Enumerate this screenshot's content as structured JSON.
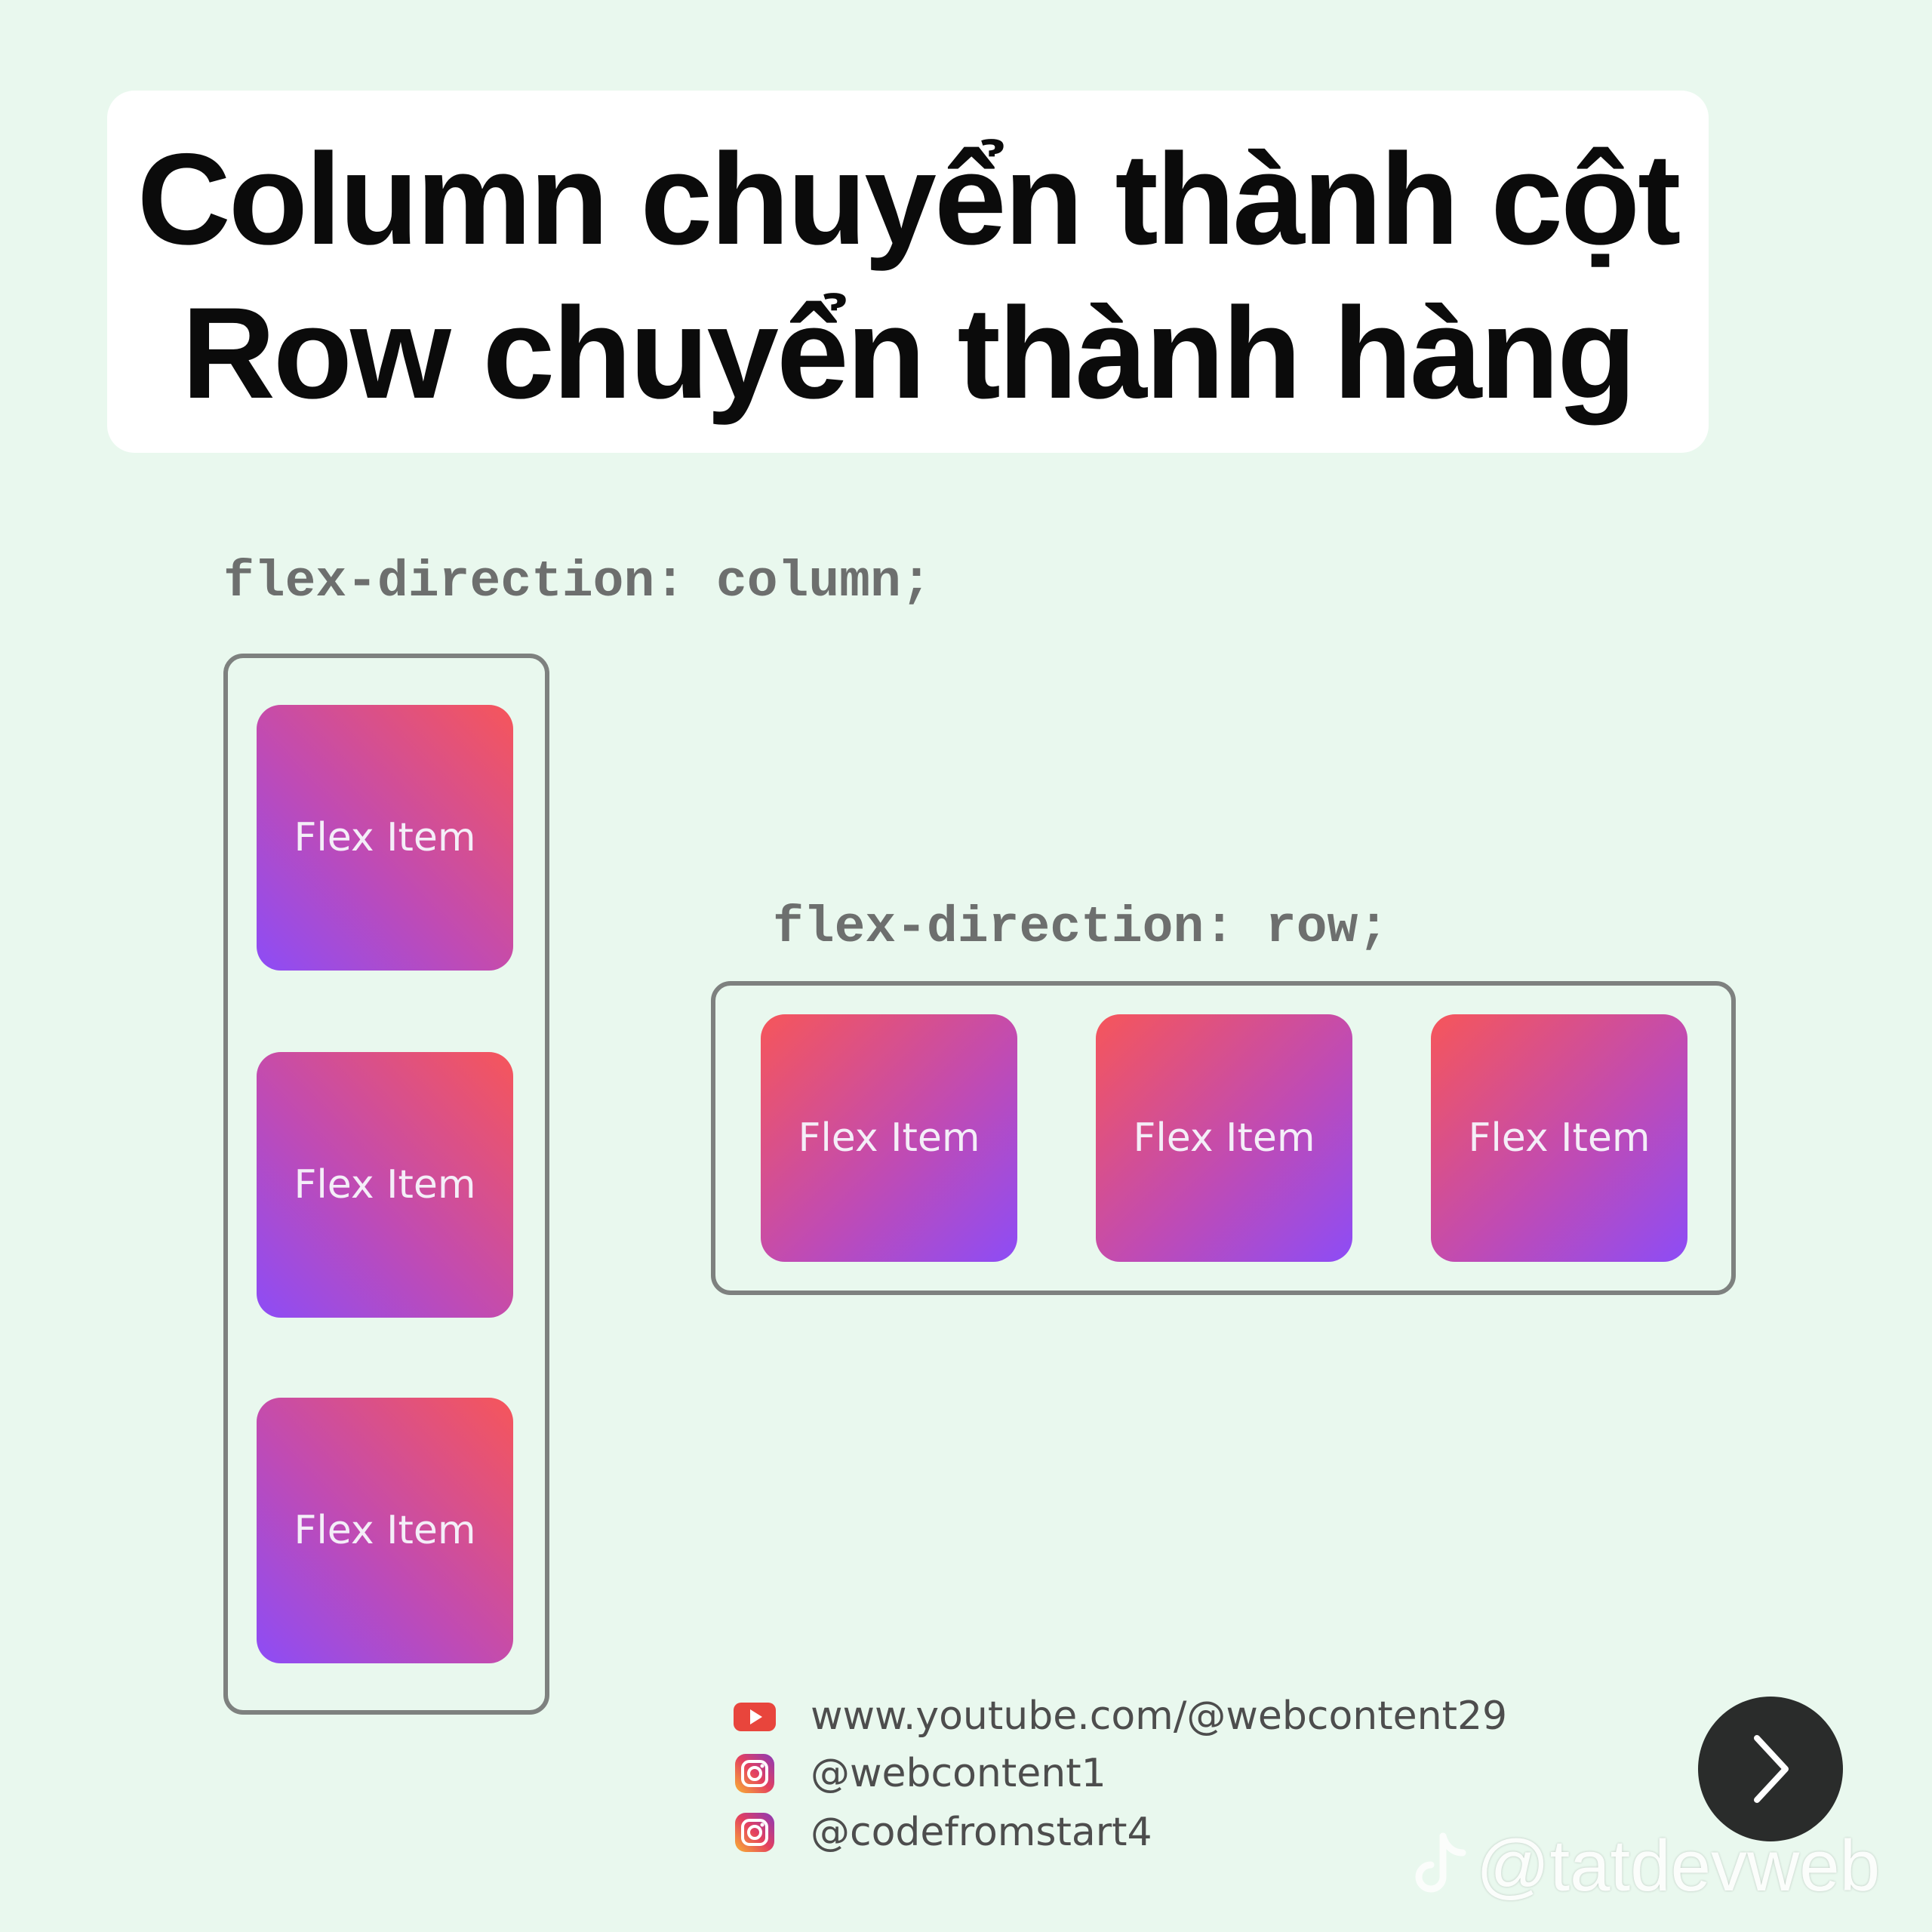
{
  "title": {
    "line1": "Column chuyển thành cột",
    "line2": "Row chuyển thành hàng"
  },
  "column_demo": {
    "code_label": "flex-direction: column;",
    "items": [
      "Flex Item",
      "Flex Item",
      "Flex Item"
    ]
  },
  "row_demo": {
    "code_label": "flex-direction: row;",
    "items": [
      "Flex Item",
      "Flex Item",
      "Flex Item"
    ]
  },
  "footer": {
    "links": [
      {
        "icon": "youtube-icon",
        "text": "www.youtube.com/@webcontent29"
      },
      {
        "icon": "instagram-icon",
        "text": "@webcontent1"
      },
      {
        "icon": "instagram-icon",
        "text": "@codefromstart4"
      }
    ]
  },
  "navigation": {
    "next_icon": "chevron-right-icon"
  },
  "watermark": {
    "icon": "tiktok-icon",
    "text": "@tatdevweb"
  },
  "colors": {
    "background": "#e9f8ee",
    "card": "#ffffff",
    "item_gradient_start": "#f6565a",
    "item_gradient_end": "#8d4cf6",
    "container_border": "#7e817f",
    "code_text": "#6d6f6e",
    "next_button": "#2a2c2b"
  }
}
